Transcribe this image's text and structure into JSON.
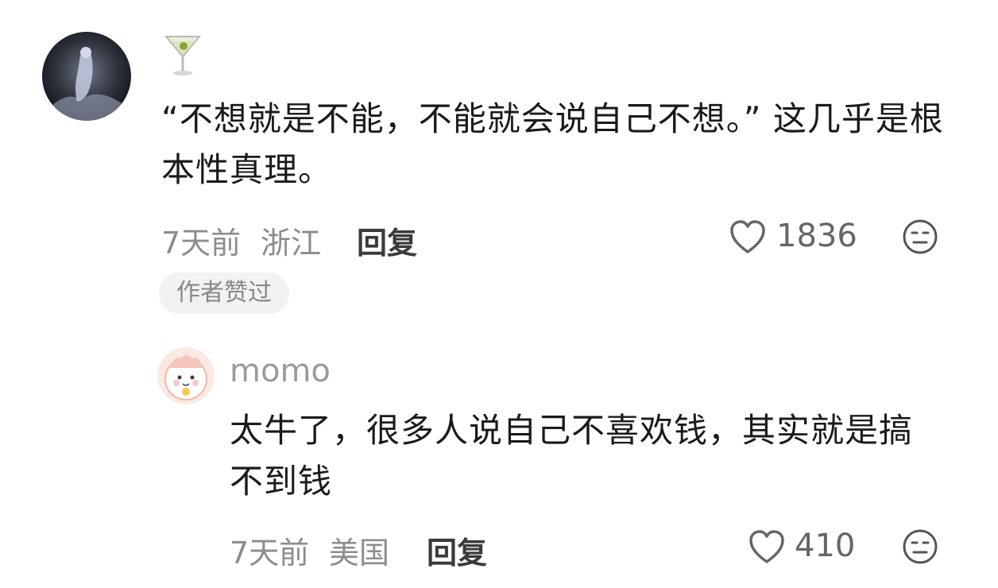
{
  "comment": {
    "text": "“不想就是不能，不能就会说自己不想。” 这几乎是根本性真理。",
    "time": "7天前",
    "location": "浙江",
    "reply_label": "回复",
    "likes": "1836",
    "badge": "作者赞过"
  },
  "reply": {
    "username": "momo",
    "text": "太牛了，很多人说自己不喜欢钱，其实就是搞不到钱",
    "time": "7天前",
    "location": "美国",
    "reply_label": "回复",
    "likes": "410"
  },
  "icons": {
    "username_icon": "cocktail-glass-icon",
    "like": "heart-outline-icon",
    "reaction": "face-icon"
  }
}
